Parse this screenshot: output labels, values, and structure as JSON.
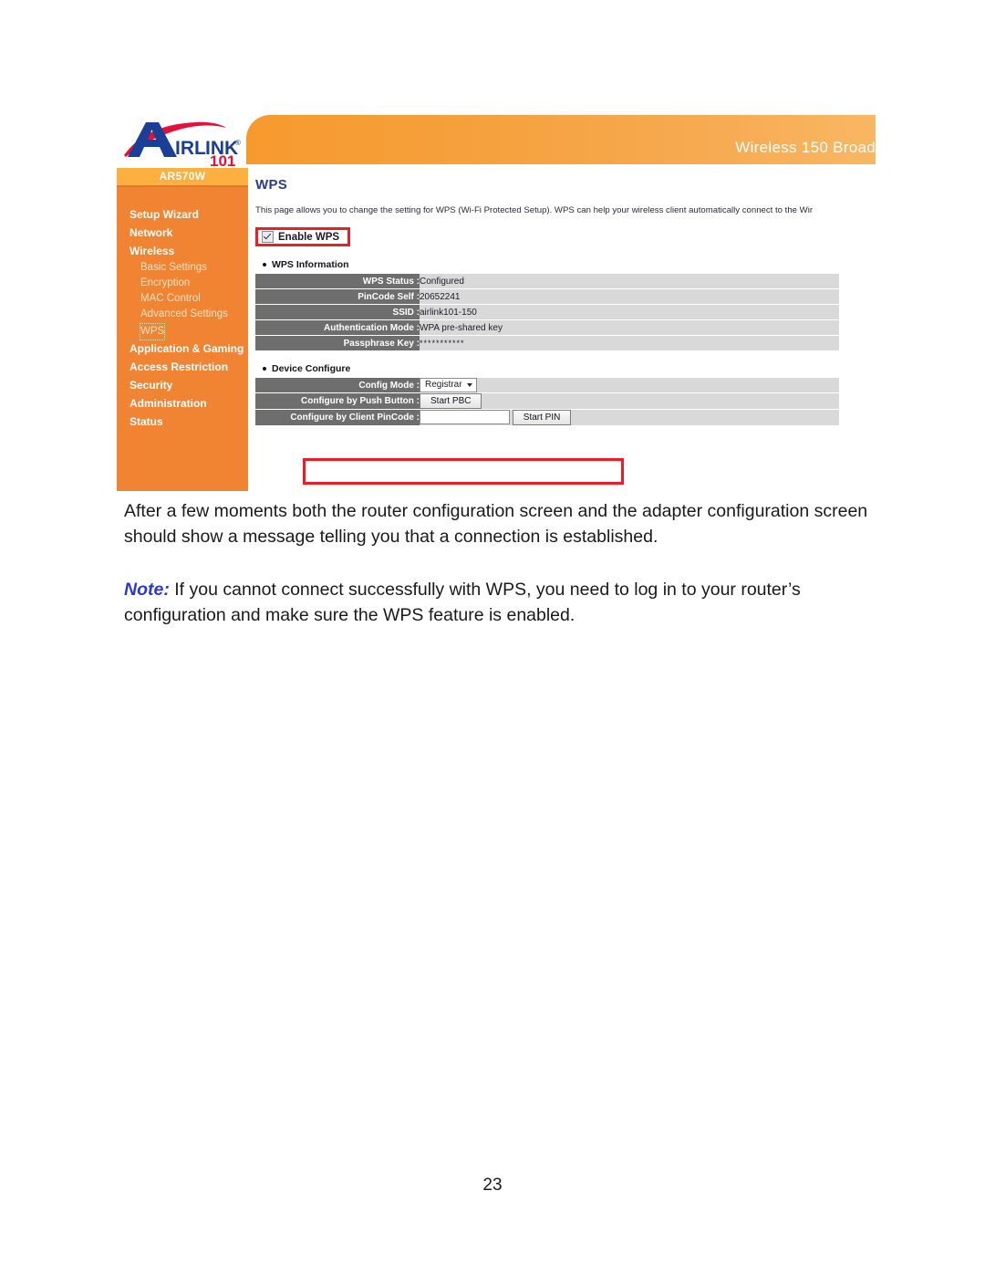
{
  "document": {
    "page_number": "23",
    "paragraphs": [
      "After a few moments both the router configuration screen and the adapter configuration screen should show a message telling you that a connection is established."
    ],
    "note": {
      "keyword": "Note:",
      "text": " If you cannot connect successfully with WPS, you need to log in to your router’s configuration and make sure the WPS feature is enabled."
    }
  },
  "screenshot": {
    "header": {
      "title": "Wireless 150 Broad",
      "logo_text": "AIRLINK",
      "logo_sub": "101",
      "logo_trademark": "®"
    },
    "sidebar": {
      "model_badge": "AR570W",
      "items": [
        {
          "label": "Setup Wizard",
          "level": "top"
        },
        {
          "label": "Network",
          "level": "top"
        },
        {
          "label": "Wireless",
          "level": "top"
        },
        {
          "label": "Basic Settings",
          "level": "sub"
        },
        {
          "label": "Encryption",
          "level": "sub"
        },
        {
          "label": "MAC Control",
          "level": "sub"
        },
        {
          "label": "Advanced Settings",
          "level": "sub"
        },
        {
          "label": "WPS",
          "level": "sub",
          "selected": true
        },
        {
          "label": "Application & Gaming",
          "level": "top"
        },
        {
          "label": "Access Restriction",
          "level": "top"
        },
        {
          "label": "Security",
          "level": "top"
        },
        {
          "label": "Administration",
          "level": "top"
        },
        {
          "label": "Status",
          "level": "top"
        }
      ]
    },
    "main": {
      "page_title": "WPS",
      "description": "This page allows you to change the setting for WPS (Wi-Fi Protected Setup). WPS can help your wireless client automatically connect to the Wir",
      "enable_wps_label": "Enable WPS",
      "enable_wps_checked": true,
      "wps_information": {
        "heading": "WPS Information",
        "rows": [
          {
            "label": "WPS Status :",
            "value": "Configured"
          },
          {
            "label": "PinCode Self :",
            "value": "20652241"
          },
          {
            "label": "SSID :",
            "value": "airlink101-150"
          },
          {
            "label": "Authentication Mode :",
            "value": "WPA pre-shared key"
          },
          {
            "label": "Passphrase Key :",
            "value": "***********"
          }
        ]
      },
      "device_configure": {
        "heading": "Device Configure",
        "config_mode_label": "Config Mode :",
        "config_mode_value": "Registrar",
        "push_button_label": "Configure by Push Button :",
        "push_button_text": "Start PBC",
        "client_pincode_label": "Configure by Client PinCode :",
        "client_pincode_value": "",
        "start_pin_text": "Start PIN"
      }
    },
    "colors": {
      "header_orange": "#f5a03c",
      "sidebar_orange": "#f08432",
      "badge_orange": "#fbb040",
      "highlight_red": "#ee1c25",
      "label_gray": "#6e6e6e",
      "value_gray": "#d9d9d9",
      "title_blue": "#2b3c8e",
      "note_blue": "#2a3ad0"
    }
  }
}
